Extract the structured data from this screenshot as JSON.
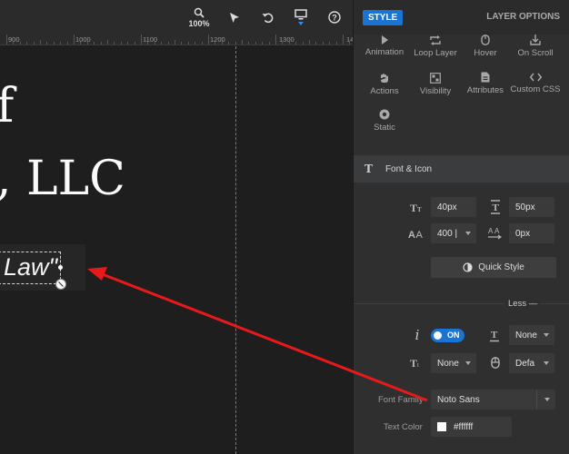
{
  "toolbar": {
    "zoom_label": "100%",
    "icons": [
      "zoom-icon",
      "select-arrow-icon",
      "undo-icon",
      "desktop-icon",
      "help-icon"
    ]
  },
  "ruler": {
    "labels": [
      "900",
      "1000",
      "1100",
      "1200",
      "1300",
      "14"
    ]
  },
  "canvas": {
    "text_line1": "f",
    "text_line2": ", LLC",
    "selected_layer_text": "Law\"",
    "guide_color": "#2d8ae8"
  },
  "panel": {
    "style_label": "STYLE",
    "layer_options_label": "LAYER OPTIONS",
    "tabs": [
      {
        "label": "Animation",
        "icon": "play-icon"
      },
      {
        "label": "Loop Layer",
        "icon": "loop-icon"
      },
      {
        "label": "Hover",
        "icon": "mouse-icon"
      },
      {
        "label": "On Scroll",
        "icon": "scroll-icon"
      },
      {
        "label": "Actions",
        "icon": "actions-icon"
      },
      {
        "label": "Visibility",
        "icon": "eye-icon"
      },
      {
        "label": "Attributes",
        "icon": "attributes-icon"
      },
      {
        "label": "Custom CSS",
        "icon": "code-icon"
      },
      {
        "label": "Static",
        "icon": "static-icon"
      }
    ],
    "section_title": "Font & Icon",
    "font_size": "40px",
    "line_height": "50px",
    "font_weight": "400 |",
    "letter_spacing": "0px",
    "quick_style_label": "Quick Style",
    "less_label": "Less  —",
    "toggle_label": "ON",
    "text_transform": "None",
    "text_decoration": "None",
    "cursor": "Defa",
    "font_family_label": "Font Family",
    "font_family_value": "Noto Sans",
    "text_color_label": "Text Color",
    "text_color_value": "#ffffff",
    "accent_color": "#1b74d1"
  },
  "annotation": {
    "arrow_color": "#e8191a"
  }
}
